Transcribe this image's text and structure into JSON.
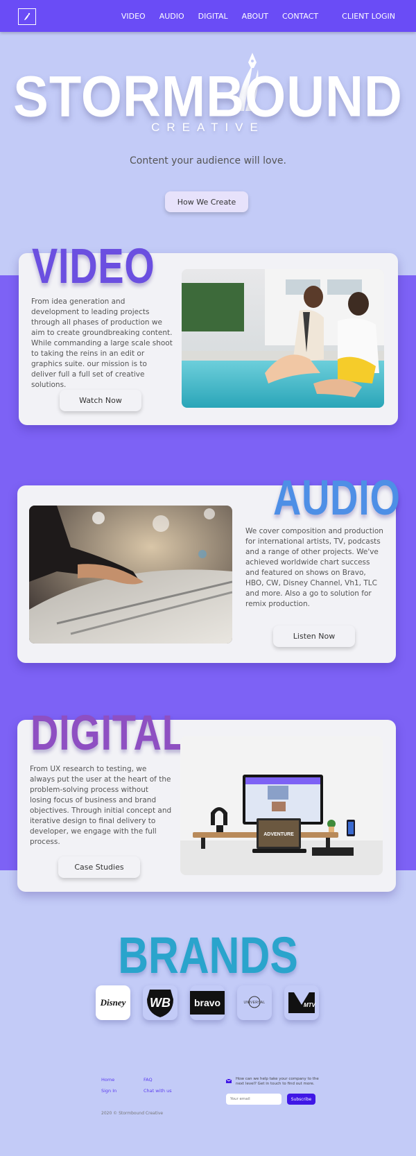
{
  "nav": {
    "items": [
      "VIDEO",
      "AUDIO",
      "DIGITAL",
      "ABOUT",
      "CONTACT"
    ],
    "login": "CLIENT LOGIN"
  },
  "hero": {
    "title": "STORMBOUND",
    "subtitle": "CREATIVE",
    "tagline": "Content your audience will love.",
    "button": "How We Create"
  },
  "video": {
    "heading": "VIDEO",
    "text": "From idea generation and development to leading projects through all phases of production we aim to create groundbreaking content. While commanding a large scale shoot to taking the reins in an edit or graphics suite. our mission is to deliver full a full set of creative solutions.",
    "button": "Watch Now"
  },
  "audio": {
    "heading": "AUDIO",
    "text": "We cover composition and production for international artists, TV, podcasts and a range of other projects. We've achieved worldwide chart success and featured on shows on Bravo, HBO, CW, Disney Channel, Vh1, TLC and more. Also a go to solution for remix production.",
    "button": "Listen Now"
  },
  "digital": {
    "heading": "DIGITAL",
    "text": "From UX research to testing, we always put the user at the heart of the problem-solving process without losing focus of business and brand objectives. Through initial concept and iterative design to final delivery to developer, we engage with the full process.",
    "button": "Case Studies",
    "screen_text": "ADVENTURE"
  },
  "brands": {
    "heading": "BRANDS",
    "logos": [
      "Disney",
      "WB",
      "bravo",
      "UNIVERSAL",
      "MTV"
    ]
  },
  "footer": {
    "links": [
      "Home",
      "FAQ",
      "Sign In",
      "Chat with us"
    ],
    "newsletter_text": "How can we help take your company to the next level? Get in touch to find out more.",
    "email_placeholder": "Your email",
    "subscribe": "Subscribe",
    "copyright": "2020 © Stormbound Creative"
  },
  "colors": {
    "nav": "#6a4cf6",
    "background": "#c3cbf7",
    "band": "#7d62f5",
    "video": "#6b4fe0",
    "audio": "#4e8fe6",
    "digital": "#8e4fc2",
    "brands": "#2aa4cc"
  }
}
